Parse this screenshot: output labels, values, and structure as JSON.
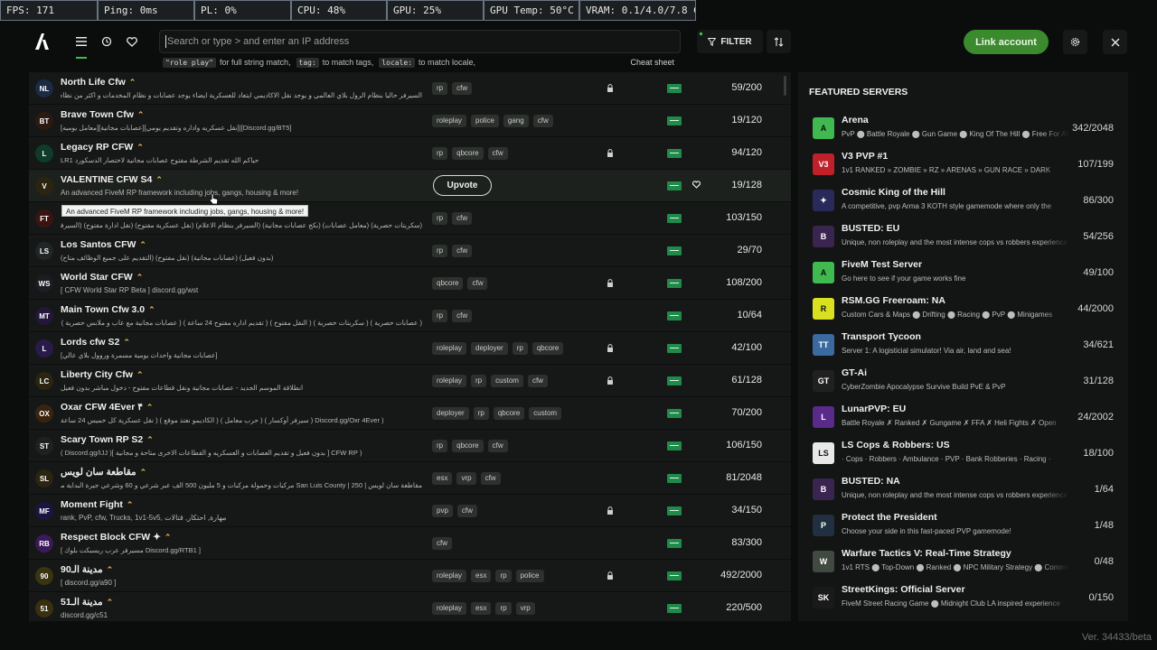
{
  "perf": [
    {
      "text": "FPS: 171",
      "w": 108
    },
    {
      "text": "Ping: 0ms",
      "w": 107
    },
    {
      "text": "PL: 0%",
      "w": 107
    },
    {
      "text": "CPU: 48%",
      "w": 106
    },
    {
      "text": "GPU: 25%",
      "w": 107
    },
    {
      "text": "GPU Temp: 50°C",
      "w": 106
    },
    {
      "text": "VRAM: 0.1/4.0/7.8 GB",
      "w": 129
    }
  ],
  "search": {
    "placeholder": "Search or type > and enter an IP address",
    "hints": [
      {
        "code": "\"role play\"",
        "text": "for full string match,"
      },
      {
        "code": "tag:",
        "text": "to match tags,"
      },
      {
        "code": "locale:",
        "text": "to match locale,"
      }
    ],
    "cheat_sheet": "Cheat sheet"
  },
  "filter_label": "FILTER",
  "link_account_label": "Link account",
  "upvote_label": "Upvote",
  "tooltip": "An advanced FiveM RP framework including jobs, gangs, housing & more!",
  "servers": [
    {
      "name": "North Life Cfw",
      "desc": "السيرفر حاليا بنظام الرول بلاي العالمي و يوجد نقل الاكاديمي ابتعاد للعسكرية ايضاء يوجد عصابات و نظام المخدمات و اكثر من نظام اخر",
      "desc_lang": "ar",
      "tags": [
        "rp",
        "cfw"
      ],
      "locked": true,
      "heart": false,
      "players": "59/200",
      "icon_bg": "#1c2a44",
      "icon_text": "NL"
    },
    {
      "name": "Brave Town Cfw",
      "desc": "[Discord.gg/BT5]|[نقل عسكريه واداره وتقديم يومي][عصابات مجانية][معامل يوميه]",
      "desc_lang": "ar",
      "tags": [
        "roleplay",
        "police",
        "gang",
        "cfw"
      ],
      "locked": false,
      "heart": false,
      "players": "19/120",
      "icon_bg": "#2a1a10",
      "icon_text": "BT"
    },
    {
      "name": "Legacy RP CFW",
      "desc": "حياكم الله تقديم الشرطة مفتوح عصابات مجانية لاختصار الدسكورد LR1",
      "desc_lang": "ar",
      "tags": [
        "rp",
        "qbcore",
        "cfw"
      ],
      "locked": true,
      "heart": false,
      "players": "94/120",
      "icon_bg": "#0f3b2a",
      "icon_text": "L"
    },
    {
      "name": "VALENTINE CFW S4",
      "desc": "An advanced FiveM RP framework including jobs, gangs, housing & more!",
      "desc_lang": "en",
      "tags": [],
      "upvote": true,
      "locked": false,
      "heart": true,
      "players": "19/128",
      "icon_bg": "#2b2410",
      "icon_text": "V"
    },
    {
      "name": "",
      "desc": "(سكربتات حصرية) (معامل عصابات) (بكج عصابات مجانية) (السيرفر بنظام الاعلام) (نقل عسكرية مفتوح) (نقل ادارة مفتوح) (السيرفر بنظام الفعيل)",
      "desc_lang": "ar",
      "tags": [
        "rp",
        "cfw"
      ],
      "locked": false,
      "heart": false,
      "players": "103/150",
      "icon_bg": "#3a1410",
      "icon_text": "FT"
    },
    {
      "name": "Los Santos CFW",
      "desc": "(بدون فعيل) (عصابات مجانية) (نقل مفتوح) (التقديم على جميع الوظائف متاح)",
      "desc_lang": "ar",
      "tags": [
        "rp",
        "cfw"
      ],
      "locked": false,
      "heart": false,
      "players": "29/70",
      "icon_bg": "#202526",
      "icon_text": "LS"
    },
    {
      "name": "World Star CFW",
      "desc": "[ CFW World Star RP Beta ] discord.gg/wst",
      "desc_lang": "en",
      "tags": [
        "qbcore",
        "cfw"
      ],
      "locked": true,
      "heart": false,
      "players": "108/200",
      "icon_bg": "#1a1d22",
      "icon_text": "WS"
    },
    {
      "name": "Main Town Cfw 3.0",
      "desc": "( عصابات حصرية ) ( سكربتات حصرية ) ( النقل مفتوح ) ( تقديم اداره مفتوح 24 ساعة ) ( عصابات مجانية مع عاب و ملابس حصرية ) ( بدون فعيل )",
      "desc_lang": "ar",
      "tags": [
        "rp",
        "cfw"
      ],
      "locked": false,
      "heart": false,
      "players": "10/64",
      "icon_bg": "#24163a",
      "icon_text": "MT"
    },
    {
      "name": "Lords cfw S2",
      "desc": "[عصابات مجانية واحداث يومية مسمرة وروول بلاي عالي]",
      "desc_lang": "ar",
      "tags": [
        "roleplay",
        "deployer",
        "rp",
        "qbcore"
      ],
      "locked": true,
      "heart": false,
      "players": "42/100",
      "icon_bg": "#2a1a4a",
      "icon_text": "L"
    },
    {
      "name": "Liberty City Cfw",
      "desc": "انطلاقة الموسم الجديد - عصابات مجانية ونقل قطاعات مفتوح - دخول مباشر بدون فعيل",
      "desc_lang": "ar",
      "tags": [
        "roleplay",
        "rp",
        "custom",
        "cfw"
      ],
      "locked": true,
      "heart": false,
      "players": "61/128",
      "icon_bg": "#2a2410",
      "icon_text": "LC"
    },
    {
      "name": "Oxar CFW 4Ever ۴",
      "desc": "( Discord.gg/Oxr 4Ever ( سيرفر أوكسار ) ( حرب معامل ) ( الكاديمو نعتذ موقع ) ( نقل عسكرية كل خميس 24 ساعة",
      "desc_lang": "ar",
      "tags": [
        "deployer",
        "rp",
        "qbcore",
        "custom"
      ],
      "locked": false,
      "heart": false,
      "players": "70/200",
      "icon_bg": "#3a2410",
      "icon_text": "OX"
    },
    {
      "name": "Scary Town RP S2",
      "desc": "( CFW RP [ بدون فعيل و تقديم العصابات و العسكريه و القطاعات الاخرى متاحة و مجانية ]( Discord.gg/IJJ )",
      "desc_lang": "ar",
      "tags": [
        "rp",
        "qbcore",
        "cfw"
      ],
      "locked": false,
      "heart": false,
      "players": "106/150",
      "icon_bg": "#202020",
      "icon_text": "ST"
    },
    {
      "name": "مقاطعة سان لويس",
      "desc": "مقاطعة سان لويس | San Luis County | 250 مركبات وحمولة مركبات و 5 مليون 500 الف عبر شرعي و 60 وشرعي جيرة البداية ملكية",
      "desc_lang": "ar",
      "tags": [
        "esx",
        "vrp",
        "cfw"
      ],
      "locked": false,
      "heart": false,
      "players": "81/2048",
      "icon_bg": "#2a2410",
      "icon_text": "SL"
    },
    {
      "name": "Moment Fight",
      "desc": "rank, PvP, cfw, Trucks, 1v1-5v5, مهارة, احتكار, قتالات",
      "desc_lang": "en",
      "tags": [
        "pvp",
        "cfw"
      ],
      "locked": true,
      "heart": false,
      "players": "34/150",
      "icon_bg": "#1a1440",
      "icon_text": "MF"
    },
    {
      "name": "Respect Block CFW ✦",
      "desc": "[ Discord.gg/RTB1 مسيرفر عرب ريسبكت بلوك ]",
      "desc_lang": "ar",
      "tags": [
        "cfw"
      ],
      "locked": false,
      "heart": false,
      "players": "83/300",
      "icon_bg": "#3a1a5a",
      "icon_text": "RB"
    },
    {
      "name": "مدينة الـ90",
      "desc": "[ discord.gg/a90 ]",
      "desc_lang": "en",
      "tags": [
        "roleplay",
        "esx",
        "rp",
        "police"
      ],
      "locked": true,
      "heart": false,
      "players": "492/2000",
      "icon_bg": "#3a3410",
      "icon_text": "90"
    },
    {
      "name": "مدينة الـ51",
      "desc": "discord.gg/c51",
      "desc_lang": "en",
      "tags": [
        "roleplay",
        "esx",
        "rp",
        "vrp"
      ],
      "locked": false,
      "heart": false,
      "players": "220/500",
      "icon_bg": "#3a3010",
      "icon_text": "51"
    }
  ],
  "featured": {
    "title": "FEATURED SERVERS",
    "items": [
      {
        "name": "Arena",
        "desc": "PvP ⬤ Battle Royale ⬤ Gun Game ⬤ King Of The Hill ⬤ Free For All",
        "players": "342/2048",
        "icon_bg": "#3fb950",
        "icon_text": "A"
      },
      {
        "name": "V3 PVP #1",
        "desc": "1v1 RANKED » ZOMBIE » RZ » ARENAS » GUN RACE » DARK",
        "players": "107/199",
        "icon_bg": "#c0202a",
        "icon_text": "V3"
      },
      {
        "name": "Cosmic King of the Hill",
        "desc": "A competitive, pvp Arma 3 KOTH style gamemode where only the",
        "players": "86/300",
        "icon_bg": "#2a2a5a",
        "icon_text": "✦"
      },
      {
        "name": "BUSTED: EU",
        "desc": "Unique, non roleplay and the most intense cops vs robbers experience",
        "players": "54/256",
        "icon_bg": "#3a2450",
        "icon_text": "B"
      },
      {
        "name": "FiveM Test Server",
        "desc": "Go here to see if your game works fine",
        "players": "49/100",
        "icon_bg": "#3fb950",
        "icon_text": "A"
      },
      {
        "name": "RSM.GG Freeroam: NA",
        "desc": "Custom Cars & Maps ⬤ Drifting ⬤ Racing ⬤ PvP ⬤ Minigames",
        "players": "44/2000",
        "icon_bg": "#d8e020",
        "icon_text": "R"
      },
      {
        "name": "Transport Tycoon",
        "desc": "Server 1: A logisticial simulator! Via air, land and sea!",
        "players": "34/621",
        "icon_bg": "#3a6aa0",
        "icon_text": "TT"
      },
      {
        "name": "GT-Ai",
        "desc": "CyberZombie Apocalypse Survive Build PvE & PvP",
        "players": "31/128",
        "icon_bg": "#202020",
        "icon_text": "GT"
      },
      {
        "name": "LunarPVP: EU",
        "desc": "Battle Royale ✗ Ranked ✗ Gungame ✗ FFA ✗ Heli Fights ✗ Open",
        "players": "24/2002",
        "icon_bg": "#5a2a8a",
        "icon_text": "L"
      },
      {
        "name": "LS Cops & Robbers: US",
        "desc": "· Cops · Robbers · Ambulance · PVP · Bank Robberies · Racing ·",
        "players": "18/100",
        "icon_bg": "#e8e8e8",
        "icon_text": "LS"
      },
      {
        "name": "BUSTED: NA",
        "desc": "Unique, non roleplay and the most intense cops vs robbers experience",
        "players": "1/64",
        "icon_bg": "#3a2450",
        "icon_text": "B"
      },
      {
        "name": "Protect the President",
        "desc": "Choose your side in this fast-paced PVP gamemode!",
        "players": "1/48",
        "icon_bg": "#203040",
        "icon_text": "P"
      },
      {
        "name": "Warfare Tactics V: Real-Time Strategy",
        "desc": "1v1 RTS ⬤ Top-Down ⬤ Ranked ⬤ NPC Military Strategy ⬤ Commander",
        "players": "0/48",
        "icon_bg": "#404a40",
        "icon_text": "W"
      },
      {
        "name": "StreetKings: Official Server",
        "desc": "FiveM Street Racing Game ⬤ Midnight Club LA inspired experience",
        "players": "0/150",
        "icon_bg": "#1a1a1a",
        "icon_text": "SK"
      }
    ]
  },
  "version": "Ver. 34433/beta",
  "accent": "#3fb950"
}
